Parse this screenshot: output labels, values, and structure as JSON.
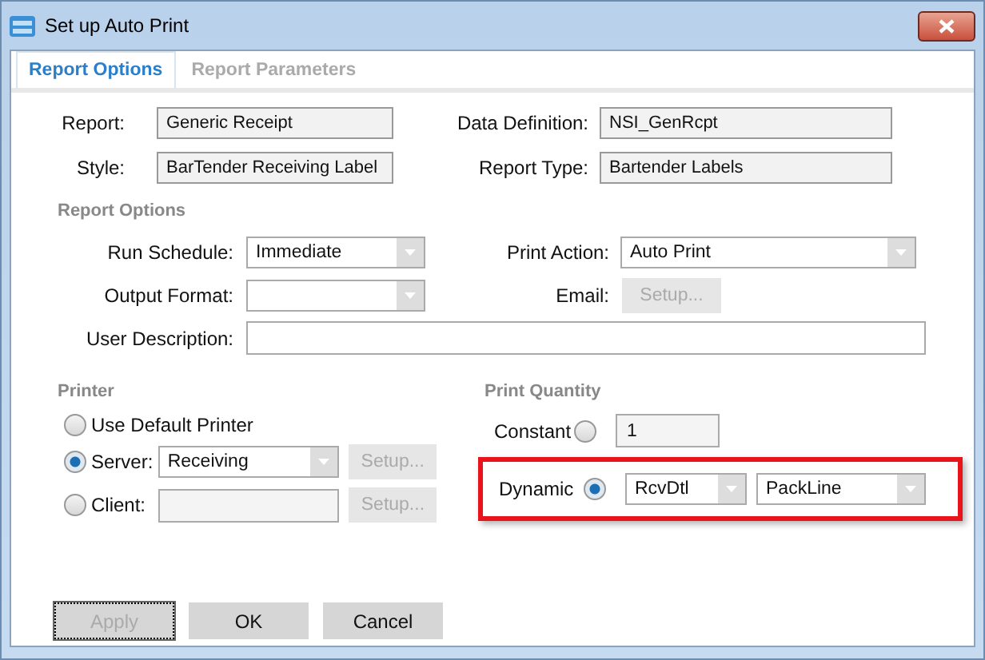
{
  "window": {
    "title": "Set up Auto Print"
  },
  "tabs": [
    {
      "label": "Report Options",
      "selected": true
    },
    {
      "label": "Report Parameters",
      "selected": false
    }
  ],
  "report_info": [
    {
      "label": "Report:",
      "value": "Generic Receipt"
    },
    {
      "label": "Data Definition:",
      "value": "NSI_GenRcpt"
    },
    {
      "label": "Style:",
      "value": "BarTender Receiving Label"
    },
    {
      "label": "Report Type:",
      "value": "Bartender Labels"
    }
  ],
  "report_options": {
    "heading": "Report Options",
    "run_schedule": {
      "label": "Run Schedule:",
      "value": "Immediate"
    },
    "print_action": {
      "label": "Print Action:",
      "value": "Auto Print"
    },
    "output_format": {
      "label": "Output Format:"
    },
    "email": {
      "label": "Email:",
      "button": "Setup...",
      "disabled": true
    },
    "user_description": {
      "label": "User Description:"
    }
  },
  "printer": {
    "heading": "Printer",
    "options": [
      {
        "label": "Use Default Printer",
        "selected": false,
        "kind": "plain"
      },
      {
        "label": "Server:",
        "selected": true,
        "kind": "dropdown",
        "value": "Receiving",
        "button": "Setup...",
        "disabled": true
      },
      {
        "label": "Client:",
        "selected": false,
        "kind": "field",
        "button": "Setup...",
        "disabled": true
      }
    ]
  },
  "print_quantity": {
    "heading": "Print Quantity",
    "constant": {
      "label": "Constant",
      "selected": false,
      "value": "1"
    },
    "dynamic": {
      "label": "Dynamic",
      "selected": true,
      "values": [
        "RcvDtl",
        "PackLine"
      ],
      "highlighted": true
    }
  },
  "buttons": [
    {
      "label": "Apply",
      "disabled": true,
      "focused": true
    },
    {
      "label": "OK",
      "disabled": false,
      "focused": false
    },
    {
      "label": "Cancel",
      "disabled": false,
      "focused": false
    }
  ]
}
